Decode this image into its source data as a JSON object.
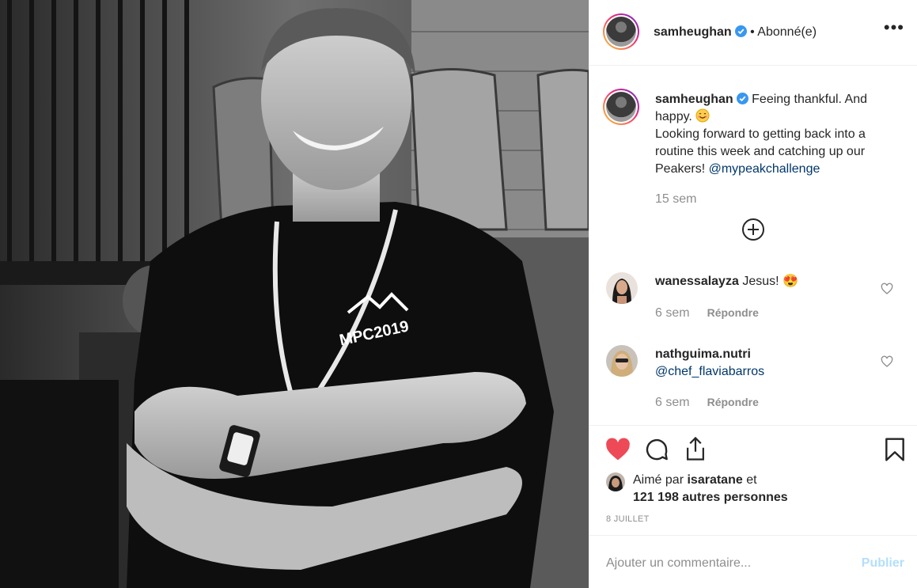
{
  "post": {
    "username": "samheughan",
    "follow_status": "• Abonné(e)",
    "more_label": "•••",
    "caption_line1": "Feeing thankful. And happy.",
    "caption_line2": "Looking forward to getting back into a routine this week and catching up our Peakers!",
    "mention": "@mypeakchallenge",
    "caption_time": "15 sem",
    "shirt_text": "MPC2019"
  },
  "comments": [
    {
      "username": "wanessalayza",
      "text": "Jesus!",
      "emoji": "😍",
      "time": "6 sem",
      "reply": "Répondre"
    },
    {
      "username": "nathguima.nutri",
      "text": "@chef_flaviabarros",
      "time": "6 sem",
      "reply": "Répondre"
    }
  ],
  "likes": {
    "prefix": "Aimé par",
    "user": "isaratane",
    "joiner": "et",
    "others": "121 198 autres personnes"
  },
  "date": "8 JUILLET",
  "comment_box": {
    "placeholder": "Ajouter un commentaire...",
    "publish": "Publier"
  },
  "colors": {
    "like_red": "#ed4956",
    "link_blue": "#00376b",
    "verified_blue": "#3897f0",
    "muted": "#8e8e8e",
    "publish_disabled": "#b2dffc"
  }
}
